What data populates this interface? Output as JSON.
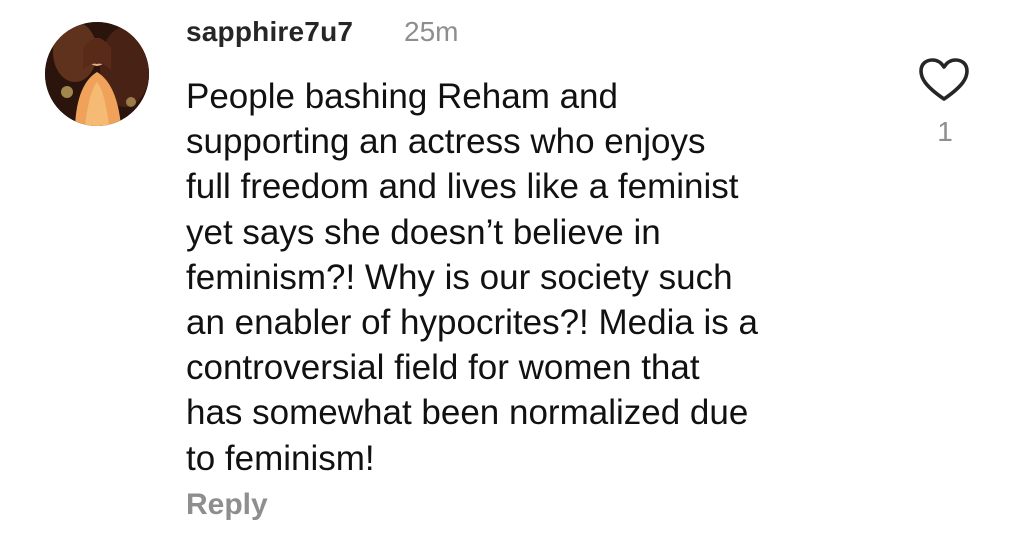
{
  "comment": {
    "username": "sapphire7u7",
    "timestamp": "25m",
    "text_lines": [
      "People bashing Reham and",
      "supporting an actress who enjoys",
      "full freedom and lives like a feminist",
      "yet says she doesn’t believe in",
      "feminism?! Why is our society such",
      "an enabler of hypocrites?! Media is a",
      "controversial field for women that",
      "has somewhat been normalized due",
      "to feminism!"
    ],
    "reply_label": "Reply",
    "like_count": "1",
    "like_icon": "heart-outline-icon"
  }
}
